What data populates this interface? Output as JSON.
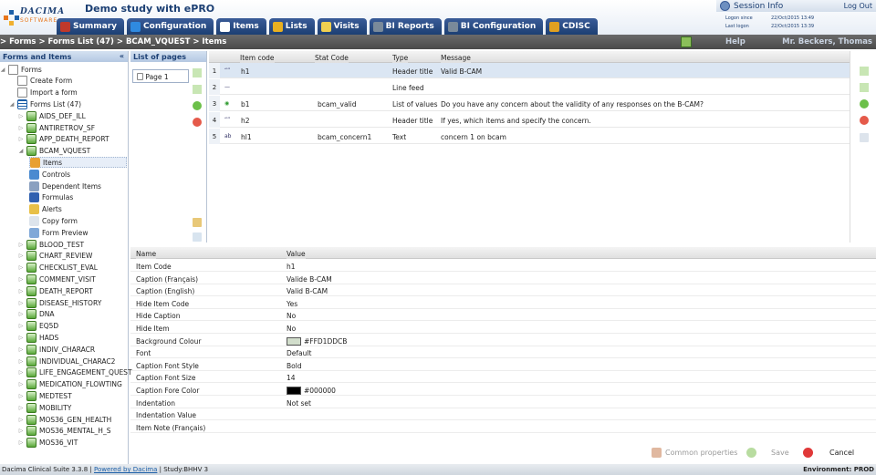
{
  "app": {
    "brand_top": "DACIMA",
    "brand_bottom": "SOFTWARE",
    "title": "Demo study with ePRO"
  },
  "tabs": [
    {
      "label": "Summary",
      "icon": "summary-icon",
      "color": "#c0392b"
    },
    {
      "label": "Configuration",
      "icon": "gear-icon",
      "color": "#2f8ae0"
    },
    {
      "label": "Items",
      "icon": "document-icon",
      "color": "#ffffff"
    },
    {
      "label": "Lists",
      "icon": "list-icon",
      "color": "#e8b020"
    },
    {
      "label": "Visits",
      "icon": "calendar-icon",
      "color": "#f0d050"
    },
    {
      "label": "BI Reports",
      "icon": "gear-icon",
      "color": "#7a8a9a"
    },
    {
      "label": "BI Configuration",
      "icon": "gear-icon",
      "color": "#7a8a9a"
    },
    {
      "label": "CDISC",
      "icon": "globe-icon",
      "color": "#e0a020"
    }
  ],
  "session": {
    "title": "Session Info",
    "logout": "Log Out",
    "logon_since_label": "Logon since",
    "logon_since_value": "22/Oct/2015 13:49",
    "last_logon_label": "Last logon",
    "last_logon_value": "22/Oct/2015 13:39"
  },
  "breadcrumb": "> Forms > Forms List (47) > BCAM_VQUEST > Items",
  "help": "Help",
  "user": "Mr. Beckers, Thomas",
  "tree": {
    "title": "Forms and Items",
    "collapse": "«",
    "forms_label": "Forms",
    "create_form": "Create Form",
    "import_form": "Import a form",
    "forms_list": "Forms List (47)",
    "forms_before": [
      "AIDS_DEF_ILL",
      "ANTIRETROV_SF",
      "APP_DEATH_REPORT"
    ],
    "open_form": "BCAM_VQUEST",
    "sub": [
      "Items",
      "Controls",
      "Dependent Items",
      "Formulas",
      "Alerts",
      "Copy form",
      "Form Preview"
    ],
    "forms_after": [
      "BLOOD_TEST",
      "CHART_REVIEW",
      "CHECKLIST_EVAL",
      "COMMENT_VISIT",
      "DEATH_REPORT",
      "DISEASE_HISTORY",
      "DNA",
      "EQ5D",
      "HADS",
      "INDIV_CHARACR",
      "INDIVIDUAL_CHARAC2",
      "LIFE_ENGAGEMENT_QUEST",
      "MEDICATION_FLOWTING",
      "MEDTEST",
      "MOBILITY",
      "MOS36_GEN_HEALTH",
      "MOS36_MENTAL_H_S",
      "MOS36_VIT"
    ]
  },
  "pages": {
    "title": "List of pages",
    "items": [
      "Page 1"
    ]
  },
  "grid": {
    "headers": [
      "Item code",
      "Stat Code",
      "Type",
      "Message"
    ],
    "rows": [
      {
        "num": "1",
        "code": "h1",
        "stat": "",
        "type": "Header title",
        "message": "Valid B-CAM"
      },
      {
        "num": "2",
        "code": "",
        "stat": "",
        "type": "Line feed",
        "message": ""
      },
      {
        "num": "3",
        "code": "b1",
        "stat": "bcam_valid",
        "type": "List of values",
        "message": "Do you have any concern about the validity of any responses on the B-CAM?"
      },
      {
        "num": "4",
        "code": "h2",
        "stat": "",
        "type": "Header title",
        "message": "If yes, which items and specify the concern."
      },
      {
        "num": "5",
        "code": "hl1",
        "stat": "bcam_concern1",
        "type": "Text",
        "message": "concern 1 on bcam"
      }
    ]
  },
  "props": {
    "name_header": "Name",
    "value_header": "Value",
    "rows": [
      {
        "name": "Item Code",
        "value": "h1"
      },
      {
        "name": "Caption (Français)",
        "value": "Valide B-CAM"
      },
      {
        "name": "Caption (English)",
        "value": "Valid B-CAM"
      },
      {
        "name": "Hide Item Code",
        "value": "Yes"
      },
      {
        "name": "Hide Caption",
        "value": "No"
      },
      {
        "name": "Hide Item",
        "value": "No"
      },
      {
        "name": "Background Colour",
        "value": "#FFD1DDCB",
        "swatch": "#d1ddcb"
      },
      {
        "name": "Font",
        "value": "Default"
      },
      {
        "name": "Caption Font Style",
        "value": "Bold"
      },
      {
        "name": "Caption Font Size",
        "value": "14"
      },
      {
        "name": "Caption Fore Color",
        "value": "#000000",
        "swatch": "#000000"
      },
      {
        "name": "Indentation",
        "value": "Not set"
      },
      {
        "name": "Indentation Value",
        "value": ""
      },
      {
        "name": "Item Note (Français)",
        "value": ""
      }
    ]
  },
  "actions": {
    "common": "Common properties",
    "save": "Save",
    "cancel": "Cancel"
  },
  "footer": {
    "version": "Dacima Clinical Suite 3.3.8 | ",
    "powered": "Powered by Dacima",
    "study": " | Study:BHHV 3",
    "env": "Environment: PROD"
  }
}
